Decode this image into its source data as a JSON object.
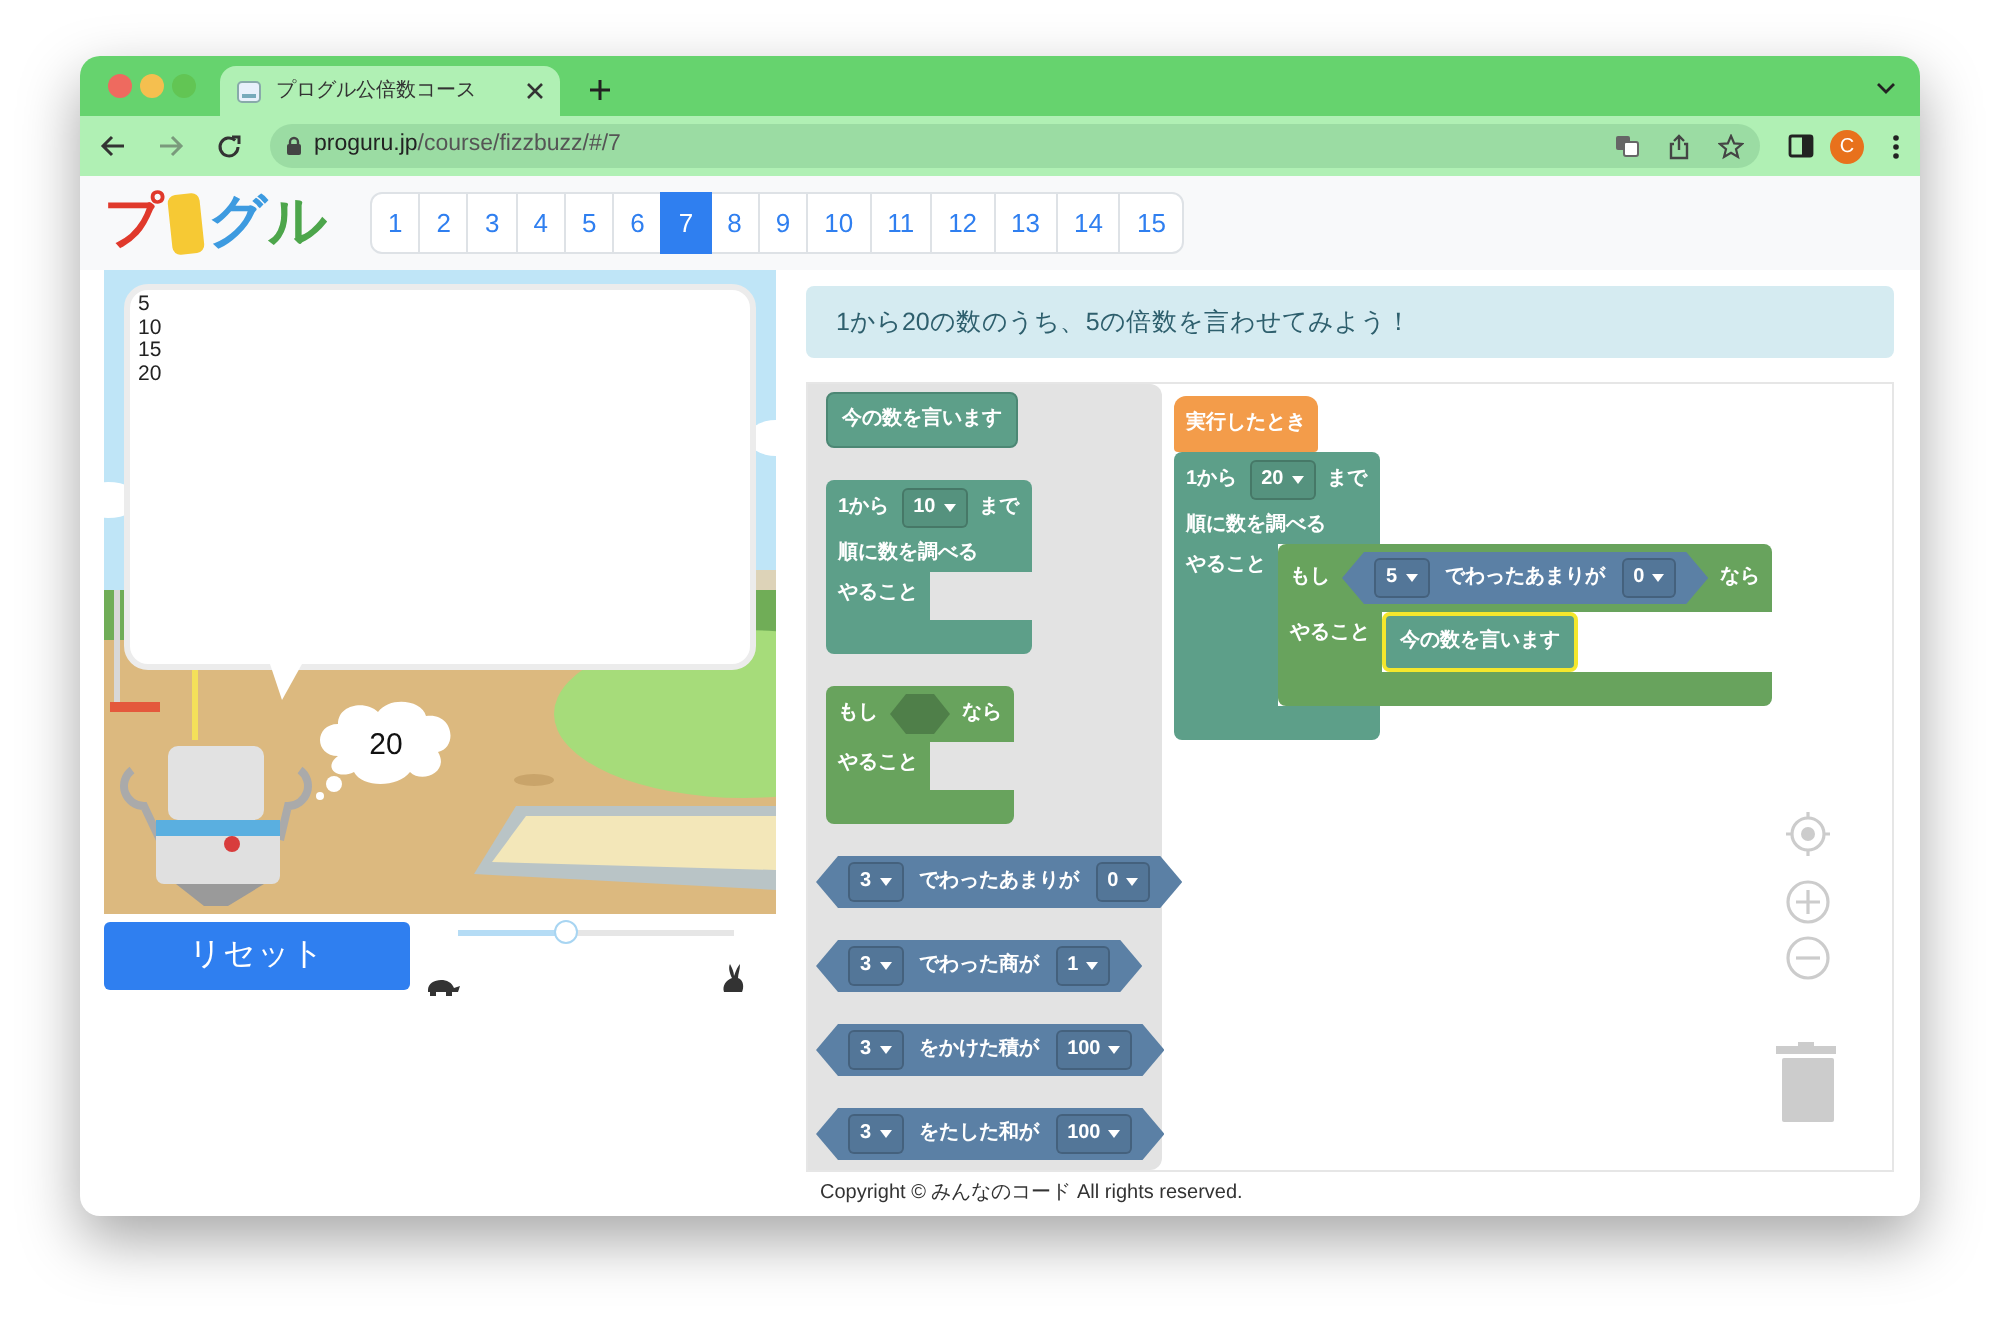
{
  "browser": {
    "tab_title": "プログル公倍数コース",
    "url_host": "proguru.jp",
    "url_path": "/course/fizzbuzz/#/7",
    "profile_initial": "C"
  },
  "logo": [
    {
      "kind": "letter",
      "text": "プ",
      "color": "#e0392b"
    },
    {
      "kind": "tile",
      "color": "#f6c934"
    },
    {
      "kind": "letter",
      "text": "グ",
      "color": "#3d9be0"
    },
    {
      "kind": "letter",
      "text": "ル",
      "color": "#4da64b"
    }
  ],
  "pages": [
    {
      "label": "1",
      "selected": false
    },
    {
      "label": "2",
      "selected": false
    },
    {
      "label": "3",
      "selected": false
    },
    {
      "label": "4",
      "selected": false
    },
    {
      "label": "5",
      "selected": false
    },
    {
      "label": "6",
      "selected": false
    },
    {
      "label": "7",
      "selected": true
    },
    {
      "label": "8",
      "selected": false
    },
    {
      "label": "9",
      "selected": false
    },
    {
      "label": "10",
      "selected": false
    },
    {
      "label": "11",
      "selected": false
    },
    {
      "label": "12",
      "selected": false
    },
    {
      "label": "13",
      "selected": false
    },
    {
      "label": "14",
      "selected": false
    },
    {
      "label": "15",
      "selected": false
    }
  ],
  "stage": {
    "output_lines": [
      "5",
      "10",
      "15",
      "20"
    ],
    "thought": "20"
  },
  "reset_button": "リセット",
  "speed_slider": {
    "level": 0.39
  },
  "instruction": "1から20の数のうち、5の倍数を言わせてみよう！",
  "toolbox": [
    {
      "kind": "statement",
      "label": "今の数を言います",
      "selected": false
    },
    {
      "kind": "loop",
      "rows": [
        [
          {
            "kind": "text",
            "text": "1から"
          },
          {
            "kind": "dropdown",
            "value": "10"
          },
          {
            "kind": "text",
            "text": "まで"
          }
        ],
        [
          {
            "kind": "text",
            "text": "順に数を調べる"
          }
        ]
      ],
      "do": "やること"
    },
    {
      "kind": "if",
      "rows": [
        [
          {
            "kind": "text",
            "text": "もし"
          },
          {
            "kind": "hole"
          },
          {
            "kind": "text",
            "text": "なら"
          }
        ]
      ],
      "do": "やること"
    },
    {
      "kind": "value",
      "parts": [
        {
          "kind": "dropdown",
          "value": "3"
        },
        {
          "kind": "text",
          "text": "でわったあまりが"
        },
        {
          "kind": "dropdown",
          "value": "0"
        }
      ]
    },
    {
      "kind": "value",
      "parts": [
        {
          "kind": "dropdown",
          "value": "3"
        },
        {
          "kind": "text",
          "text": "でわった商が"
        },
        {
          "kind": "dropdown",
          "value": "1"
        }
      ]
    },
    {
      "kind": "value",
      "parts": [
        {
          "kind": "dropdown",
          "value": "3"
        },
        {
          "kind": "text",
          "text": "をかけた積が"
        },
        {
          "kind": "dropdown",
          "value": "100"
        }
      ]
    },
    {
      "kind": "value",
      "parts": [
        {
          "kind": "dropdown",
          "value": "3"
        },
        {
          "kind": "text",
          "text": "をたした和が"
        },
        {
          "kind": "dropdown",
          "value": "100"
        }
      ]
    }
  ],
  "workspace": [
    {
      "kind": "event",
      "label": "実行したとき"
    },
    {
      "kind": "loop",
      "rows": [
        [
          {
            "kind": "text",
            "text": "1から"
          },
          {
            "kind": "dropdown",
            "value": "20"
          },
          {
            "kind": "text",
            "text": "まで"
          }
        ],
        [
          {
            "kind": "text",
            "text": "順に数を調べる"
          }
        ]
      ],
      "do": "やること",
      "body": [
        {
          "kind": "if",
          "rows": [
            [
              {
                "kind": "text",
                "text": "もし"
              },
              {
                "kind": "block",
                "block": {
                  "kind": "value",
                  "parts": [
                    {
                      "kind": "dropdown",
                      "value": "5"
                    },
                    {
                      "kind": "text",
                      "text": "でわったあまりが"
                    },
                    {
                      "kind": "dropdown",
                      "value": "0"
                    }
                  ]
                }
              },
              {
                "kind": "text",
                "text": "なら"
              }
            ]
          ],
          "do": "やること",
          "body": [
            {
              "kind": "statement",
              "label": "今の数を言います",
              "selected": true
            }
          ]
        }
      ]
    }
  ],
  "footer": "Copyright © みんなのコード All rights reserved."
}
